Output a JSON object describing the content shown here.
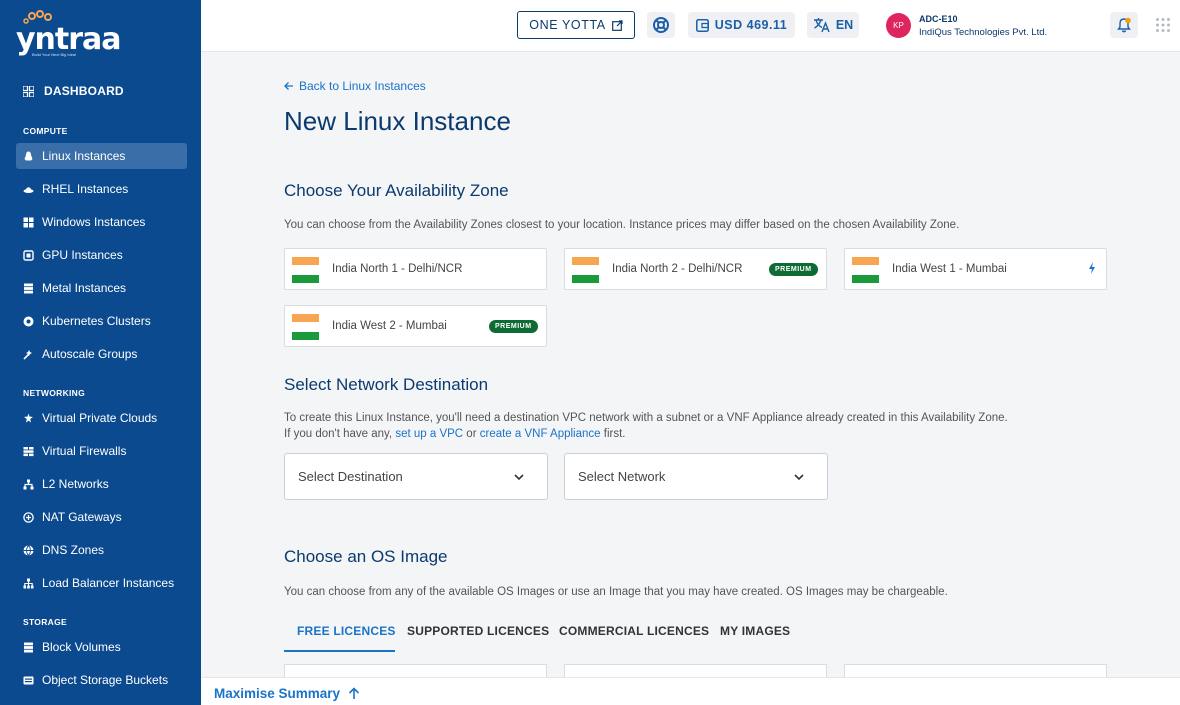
{
  "brand": {
    "name": "yntraa",
    "tagline": "Build Your Next Big Idea!"
  },
  "sidebar": {
    "dashboard_label": "DASHBOARD",
    "sections": [
      {
        "label": "COMPUTE",
        "items": [
          {
            "label": "Linux Instances",
            "icon": "linux-icon",
            "active": true
          },
          {
            "label": "RHEL Instances",
            "icon": "redhat-icon"
          },
          {
            "label": "Windows Instances",
            "icon": "windows-icon"
          },
          {
            "label": "GPU Instances",
            "icon": "gpu-icon"
          },
          {
            "label": "Metal Instances",
            "icon": "server-icon"
          },
          {
            "label": "Kubernetes Clusters",
            "icon": "kubernetes-icon"
          },
          {
            "label": "Autoscale Groups",
            "icon": "autoscale-icon"
          }
        ]
      },
      {
        "label": "NETWORKING",
        "items": [
          {
            "label": "Virtual Private Clouds",
            "icon": "cloud-icon"
          },
          {
            "label": "Virtual Firewalls",
            "icon": "firewall-icon"
          },
          {
            "label": "L2 Networks",
            "icon": "network-icon"
          },
          {
            "label": "NAT Gateways",
            "icon": "gateway-icon"
          },
          {
            "label": "DNS Zones",
            "icon": "globe-icon"
          },
          {
            "label": "Load Balancer Instances",
            "icon": "load-balancer-icon"
          }
        ]
      },
      {
        "label": "STORAGE",
        "items": [
          {
            "label": "Block Volumes",
            "icon": "volume-icon"
          },
          {
            "label": "Object Storage Buckets",
            "icon": "bucket-icon"
          }
        ]
      }
    ]
  },
  "header": {
    "yotta_label": "ONE YOTTA",
    "wallet_label": "USD 469.11",
    "lang_label": "EN",
    "avatar_initials": "KP",
    "account_id": "ADC-E10",
    "account_org": "IndiQus Technologies Pvt. Ltd."
  },
  "main": {
    "back_label": "Back to Linux Instances",
    "title": "New Linux Instance",
    "zone_section": {
      "heading": "Choose Your Availability Zone",
      "description": "You can choose from the Availability Zones closest to your location. Instance prices may differ based on the chosen Availability Zone.",
      "zones": [
        {
          "name": "India North 1 - Delhi/NCR",
          "badge": ""
        },
        {
          "name": "India North 2 - Delhi/NCR",
          "badge": "PREMIUM"
        },
        {
          "name": "India West 1 - Mumbai",
          "badge": ""
        },
        {
          "name": "India West 2 - Mumbai",
          "badge": "PREMIUM"
        }
      ]
    },
    "network_section": {
      "heading": "Select Network Destination",
      "line1": "To create this Linux Instance, you'll need a destination VPC network with a subnet or a VNF Appliance already created in this Availability Zone.",
      "line2_prefix": "If you don't have any,",
      "link_vpc": "set up a VPC",
      "line2_mid": "or",
      "link_vnf": "create a VNF Appliance",
      "line2_suffix": "first.",
      "destination_placeholder": "Select Destination",
      "network_placeholder": "Select Network"
    },
    "os_section": {
      "heading": "Choose an OS Image",
      "description": "You can choose from any of the available OS Images or use an Image that you may have created. OS Images may be chargeable.",
      "tabs": [
        "FREE LICENCES",
        "SUPPORTED LICENCES",
        "COMMERCIAL LICENCES",
        "MY IMAGES"
      ]
    }
  },
  "summary": {
    "label": "Maximise Summary"
  },
  "colors": {
    "sidebar": "#0b4a8f",
    "accent": "#1a73c8",
    "premium": "#0e6b33",
    "heading": "#0b3a6e"
  }
}
